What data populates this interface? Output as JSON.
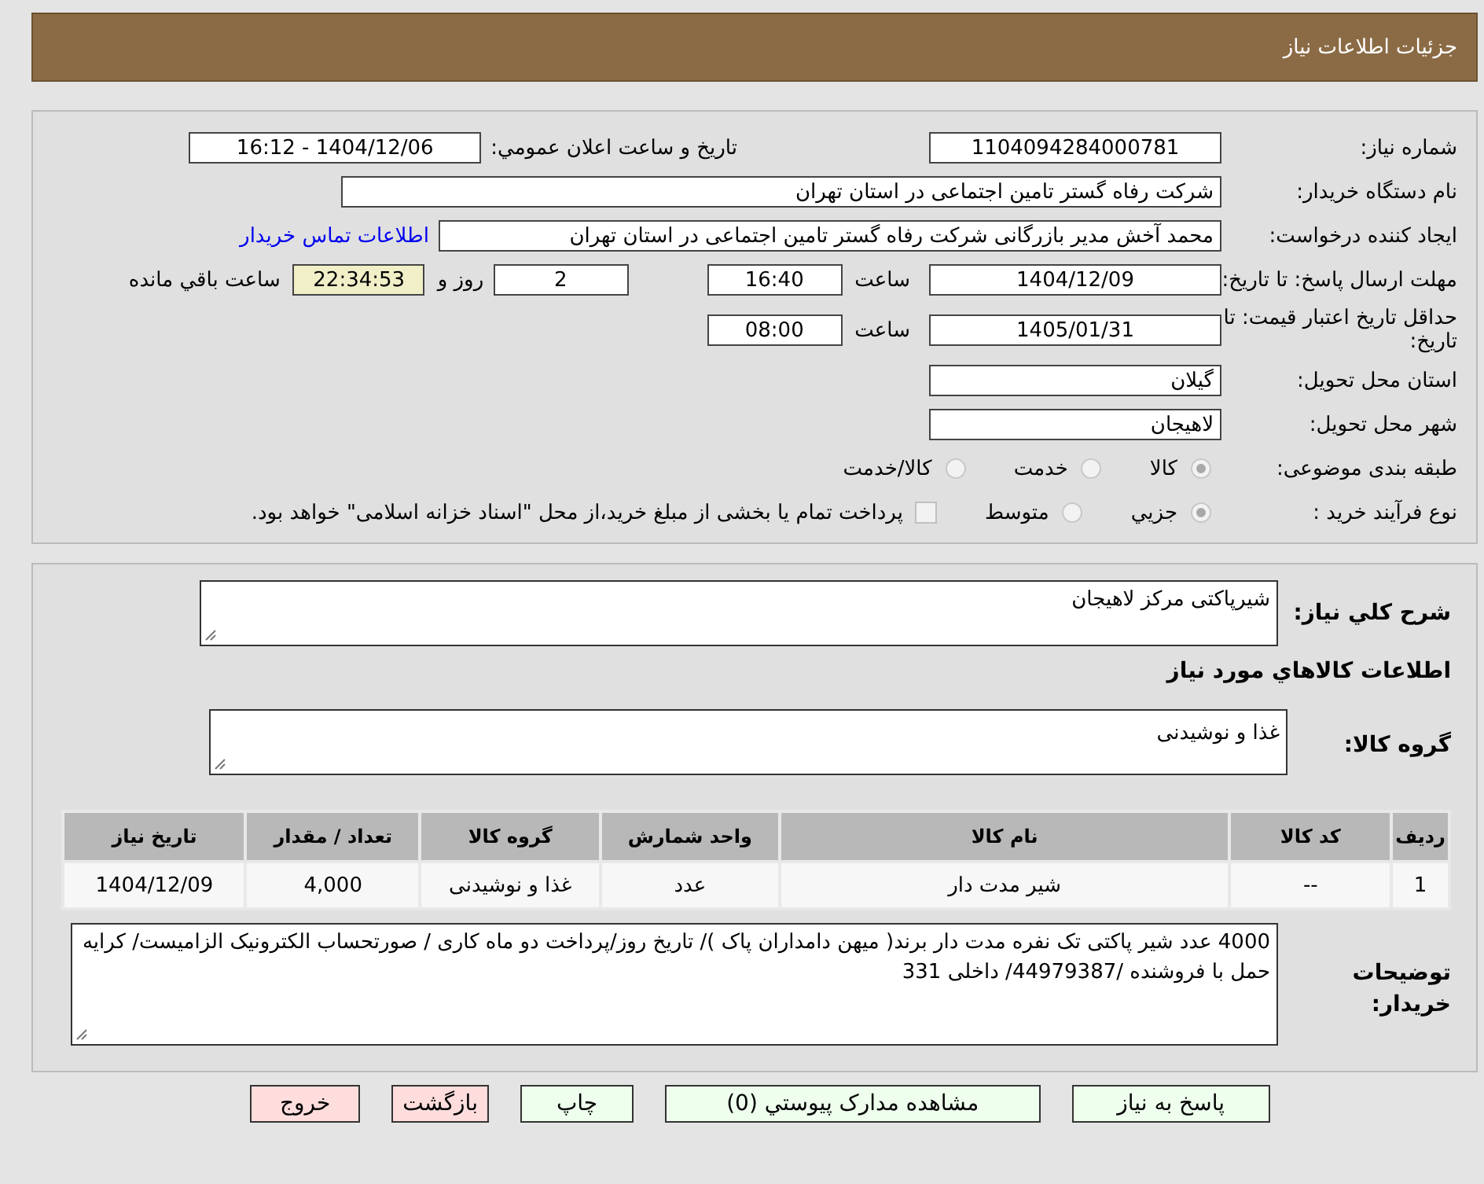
{
  "header": {
    "title": "جزئیات اطلاعات نیاز"
  },
  "need_info": {
    "need_number": {
      "label": "شماره نیاز:",
      "value": "1104094284000781"
    },
    "announce": {
      "label": "تاريخ و ساعت اعلان عمومي:",
      "value": "1404/12/06 - 16:12"
    },
    "buyer_org": {
      "label": "نام دستگاه خریدار:",
      "value": "شرکت رفاه گستر تامین اجتماعی در استان تهران"
    },
    "requester": {
      "label": "ایجاد کننده درخواست:",
      "value": "محمد آخش مدیر بازرگانی شرکت رفاه گستر تامین اجتماعی در استان تهران",
      "link": "اطلاعات تماس خریدار"
    },
    "response_deadline": {
      "label": "مهلت ارسال پاسخ: تا تاریخ:",
      "date": "1404/12/09",
      "time_label": "ساعت",
      "time": "16:40",
      "days": "2",
      "days_label": "روز و",
      "remaining": "22:34:53",
      "remaining_label": "ساعت باقي مانده"
    },
    "price_validity": {
      "label": "حداقل تاریخ اعتبار قیمت: تا تاریخ:",
      "date": "1405/01/31",
      "time_label": "ساعت",
      "time": "08:00"
    },
    "province": {
      "label": "استان محل تحویل:",
      "value": "گیلان"
    },
    "city": {
      "label": "شهر محل تحویل:",
      "value": "لاهیجان"
    },
    "category": {
      "label": "طبقه بندی موضوعی:",
      "options": [
        {
          "label": "کالا",
          "selected": true
        },
        {
          "label": "خدمت",
          "selected": false
        },
        {
          "label": "کالا/خدمت",
          "selected": false
        }
      ]
    },
    "purchase_type": {
      "label": "نوع فرآیند خرید :",
      "options": [
        {
          "label": "جزيي",
          "selected": true
        },
        {
          "label": "متوسط",
          "selected": false
        }
      ],
      "treasury": {
        "label": "پرداخت تمام یا بخشی از مبلغ خرید،از محل \"اسناد خزانه اسلامی\" خواهد بود.",
        "checked": false
      }
    }
  },
  "goods": {
    "description": {
      "label": "شرح کلي نياز:",
      "value": "شیرپاکتی مرکز لاهیجان"
    },
    "section_title": "اطلاعات کالاهاي مورد نياز",
    "group": {
      "label": "گروه کالا:",
      "value": "غذا و نوشیدنی"
    },
    "table": {
      "columns": [
        "ردیف",
        "کد کالا",
        "نام کالا",
        "واحد شمارش",
        "گروه کالا",
        "تعداد / مقدار",
        "تاریخ نیاز"
      ],
      "rows": [
        [
          "1",
          "--",
          "شیر مدت دار",
          "عدد",
          "غذا و نوشیدنی",
          "4,000",
          "1404/12/09"
        ]
      ]
    },
    "notes": {
      "label": "توضیحات خریدار:",
      "value": "4000 عدد شیر پاکتی تک نفره  مدت دار برند( میهن دامداران پاک )/ تاریخ روز/پرداخت دو ماه کاری / صورتحساب الکترونیک الزامیست/ کرایه حمل با فروشنده /44979387/ داخلی 331"
    }
  },
  "actions": [
    {
      "label": "پاسخ به نیاز",
      "kind": "normal"
    },
    {
      "label": "مشاهده مدارک پیوستي (0)",
      "kind": "normal"
    },
    {
      "label": "چاپ",
      "kind": "normal"
    },
    {
      "label": "بازگشت",
      "kind": "danger"
    },
    {
      "label": "خروج",
      "kind": "danger"
    }
  ]
}
